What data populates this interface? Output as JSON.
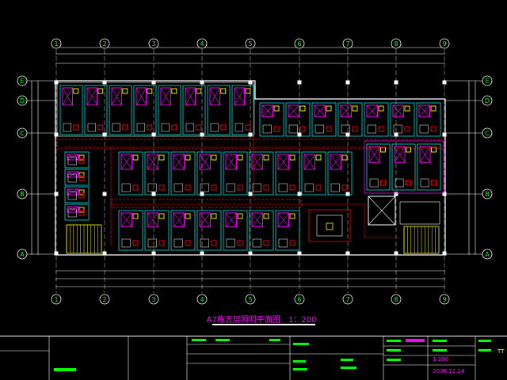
{
  "drawing": {
    "title": "A7栋五层照明平面图",
    "scale_label": "1：200",
    "columns": [
      "1",
      "2",
      "3",
      "4",
      "5",
      "6",
      "7",
      "8",
      "9"
    ],
    "rows": [
      "E",
      "D",
      "C",
      "B",
      "A"
    ],
    "title_block": {
      "scale": "1:200",
      "date": "2008.12.14",
      "sheet": "TT"
    }
  },
  "colors": {
    "background": "#000000",
    "walls": "#ffffff",
    "axis": "#00ff00",
    "columns": "#ff00ff",
    "fixtures": "#ffff00",
    "circuits": "#ff0000",
    "equipment": "#00ffff",
    "title_text": "#ff00ff"
  }
}
